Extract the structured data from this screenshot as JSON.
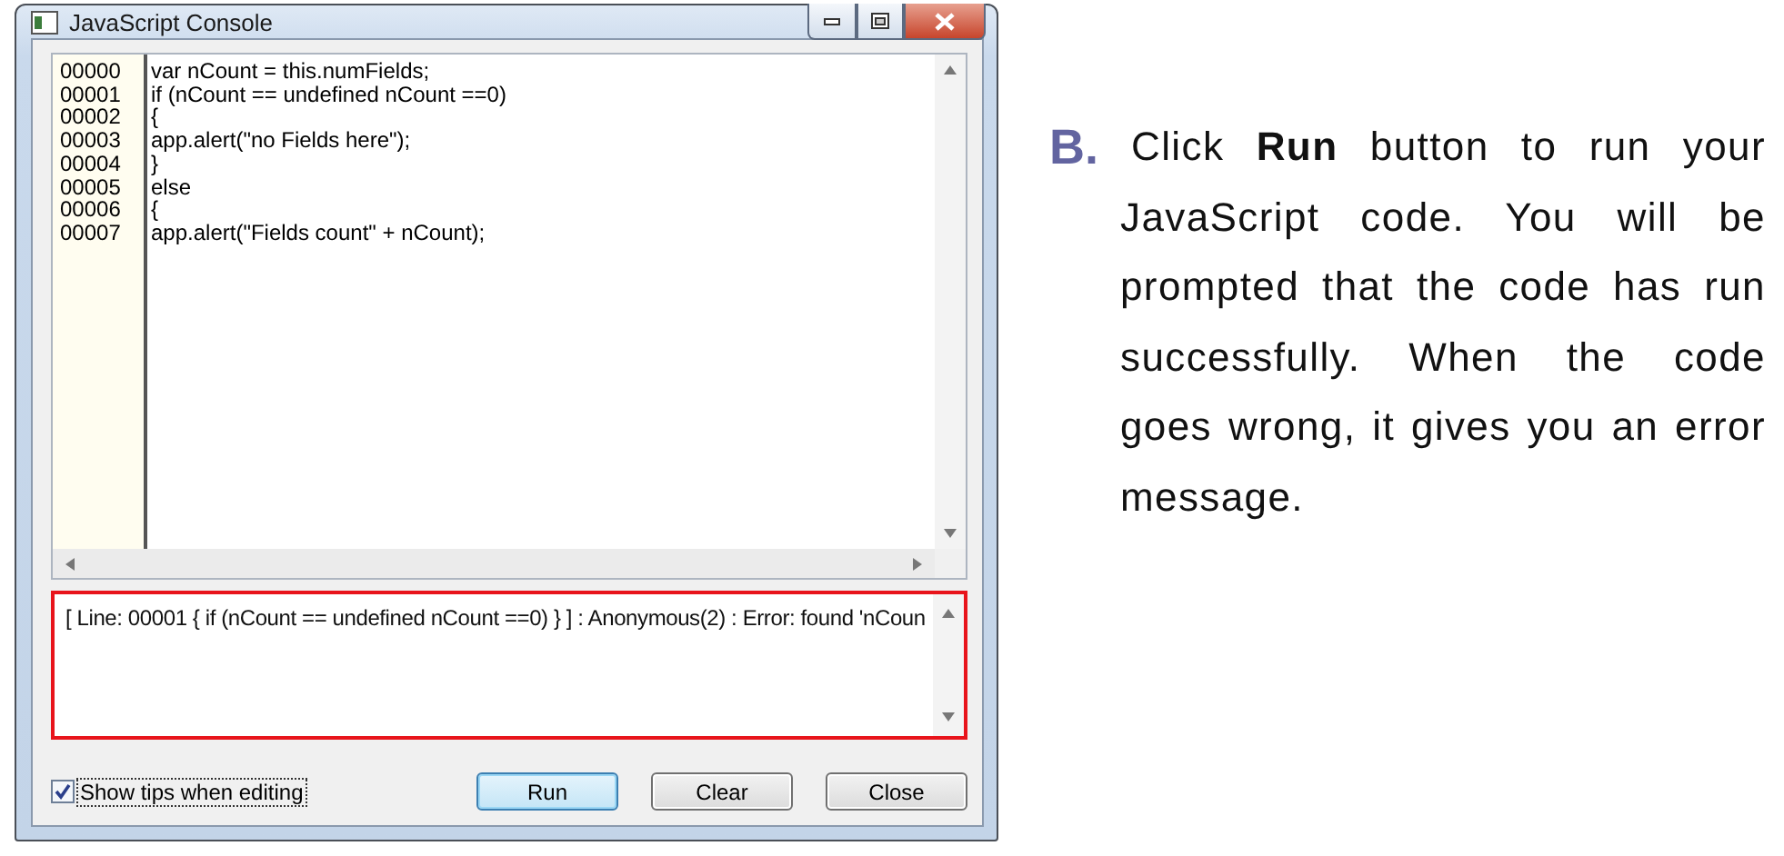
{
  "window": {
    "title": "JavaScript Console"
  },
  "editor": {
    "lines": [
      {
        "number": "00000",
        "code": "var nCount = this.numFields;"
      },
      {
        "number": "00001",
        "code": "if (nCount == undefined nCount ==0)"
      },
      {
        "number": "00002",
        "code": "{"
      },
      {
        "number": "00003",
        "code": "app.alert(\"no Fields here\");"
      },
      {
        "number": "00004",
        "code": "}"
      },
      {
        "number": "00005",
        "code": "else"
      },
      {
        "number": "00006",
        "code": "{"
      },
      {
        "number": "00007",
        "code": "app.alert(\"Fields count\" + nCount);"
      }
    ]
  },
  "output": {
    "text": "[ Line: 00001 { if (nCount == undefined nCount ==0) } ] : Anonymous(2) : Error: found 'nCoun",
    "highlighted": true
  },
  "tips_checkbox": {
    "label": "Show tips when editing",
    "checked": true
  },
  "buttons": [
    {
      "label": "Run",
      "focused": true
    },
    {
      "label": "Clear",
      "focused": false
    },
    {
      "label": "Close",
      "focused": false
    }
  ],
  "instruction": {
    "marker": "B.",
    "text": "Click **Run** button to run your JavaScript code. You will be prompted that the code has run successfully. When the code goes wrong, it gives you an error message."
  }
}
